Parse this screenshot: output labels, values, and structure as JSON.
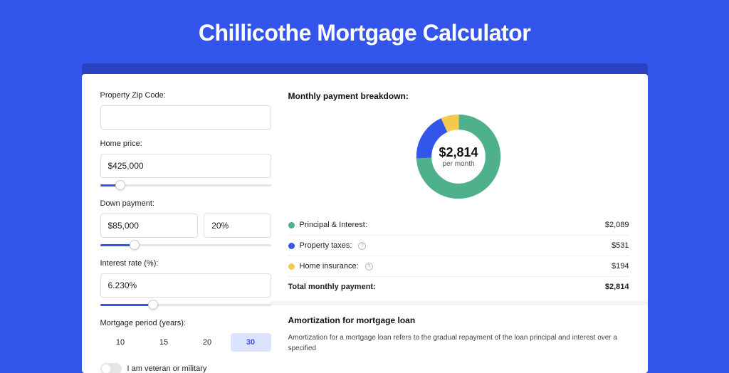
{
  "title": "Chillicothe Mortgage Calculator",
  "form": {
    "zip_label": "Property Zip Code:",
    "zip_value": "",
    "home_price_label": "Home price:",
    "home_price_value": "$425,000",
    "down_payment_label": "Down payment:",
    "down_payment_value": "$85,000",
    "down_payment_pct": "20%",
    "interest_label": "Interest rate (%):",
    "interest_value": "6.230%",
    "period_label": "Mortgage period (years):",
    "periods": [
      "10",
      "15",
      "20",
      "30"
    ],
    "period_active_index": 3,
    "veteran_label": "I am veteran or military"
  },
  "breakdown": {
    "title": "Monthly payment breakdown:",
    "center_amount": "$2,814",
    "center_sub": "per month",
    "rows": [
      {
        "label": "Principal & Interest:",
        "value": "$2,089",
        "color": "#4fb08c",
        "info": false
      },
      {
        "label": "Property taxes:",
        "value": "$531",
        "color": "#3455eb",
        "info": true
      },
      {
        "label": "Home insurance:",
        "value": "$194",
        "color": "#f4c94d",
        "info": true
      }
    ],
    "total_label": "Total monthly payment:",
    "total_value": "$2,814"
  },
  "amort": {
    "title": "Amortization for mortgage loan",
    "text": "Amortization for a mortgage loan refers to the gradual repayment of the loan principal and interest over a specified"
  },
  "chart_data": {
    "type": "pie",
    "title": "Monthly payment breakdown",
    "series": [
      {
        "name": "Principal & Interest",
        "value": 2089,
        "color": "#4fb08c"
      },
      {
        "name": "Property taxes",
        "value": 531,
        "color": "#3455eb"
      },
      {
        "name": "Home insurance",
        "value": 194,
        "color": "#f4c94d"
      }
    ],
    "total": 2814,
    "center_label": "$2,814 per month"
  }
}
